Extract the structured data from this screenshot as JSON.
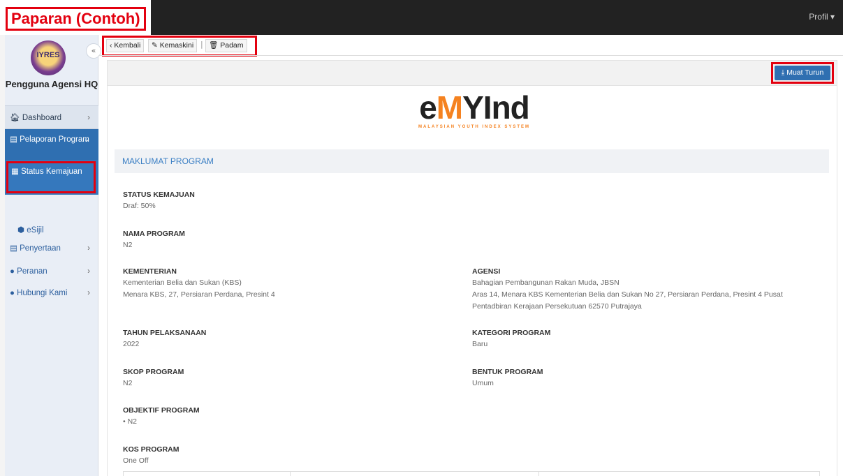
{
  "annotation": {
    "title": "Paparan (Contoh)"
  },
  "topbar": {
    "profile_label": "Profil ▾"
  },
  "sidebar": {
    "logo_text": "IYRES",
    "collapse_icon": "«",
    "user_name": "Pengguna Agensi HQ",
    "items": [
      {
        "icon": "home-icon",
        "glyph": "🏠︎",
        "label": "Dashboard",
        "chevron": "›"
      },
      {
        "icon": "report-icon",
        "glyph": "▤",
        "label": "Pelaporan Program",
        "chevron": "⌄"
      },
      {
        "icon": "table-icon",
        "glyph": "▦",
        "label": "Status Kemajuan"
      },
      {
        "icon": "certificate-icon",
        "glyph": "⬢",
        "label": "eSijil"
      },
      {
        "icon": "clipboard-icon",
        "glyph": "▤",
        "label": "Penyertaan",
        "chevron": "›"
      },
      {
        "icon": "user-icon",
        "glyph": "●",
        "label": "Peranan",
        "chevron": "›"
      },
      {
        "icon": "chat-icon",
        "glyph": "●",
        "label": "Hubungi Kami",
        "chevron": "›"
      }
    ]
  },
  "toolbar": {
    "back_label": "‹ Kembali",
    "edit_label": "✎ Kemaskini",
    "separator": "|",
    "delete_label": "🗑︎ Padam"
  },
  "content": {
    "download_label": "⤓ Muat Turun",
    "brand": {
      "prefix": "e",
      "mark": "M",
      "name": "YInd",
      "tagline": "MALAYSIAN YOUTH INDEX SYSTEM"
    },
    "section_title": "MAKLUMAT PROGRAM",
    "fields": {
      "status_kemajuan": {
        "label": "STATUS KEMAJUAN",
        "value": "Draf: 50%"
      },
      "nama_program": {
        "label": "NAMA PROGRAM",
        "value": "N2"
      },
      "kementerian": {
        "label": "KEMENTERIAN",
        "value_line1": "Kementerian Belia dan Sukan (KBS)",
        "value_line2": "Menara KBS, 27, Persiaran Perdana, Presint 4"
      },
      "agensi": {
        "label": "AGENSI",
        "value_line1": "Bahagian Pembangunan Rakan Muda, JBSN",
        "value_line2": "Aras 14, Menara KBS Kementerian Belia dan Sukan No 27, Persiaran Perdana, Presint 4 Pusat Pentadbiran Kerajaan Persekutuan 62570 Putrajaya"
      },
      "tahun": {
        "label": "TAHUN PELAKSANAAN",
        "value": "2022"
      },
      "kategori": {
        "label": "KATEGORI PROGRAM",
        "value": "Baru"
      },
      "skop": {
        "label": "SKOP PROGRAM",
        "value": "N2"
      },
      "bentuk": {
        "label": "BENTUK PROGRAM",
        "value": "Umum"
      },
      "objektif": {
        "label": "OBJEKTIF PROGRAM",
        "value": "• N2"
      },
      "kos": {
        "label": "KOS PROGRAM",
        "value": "One Off"
      }
    }
  }
}
